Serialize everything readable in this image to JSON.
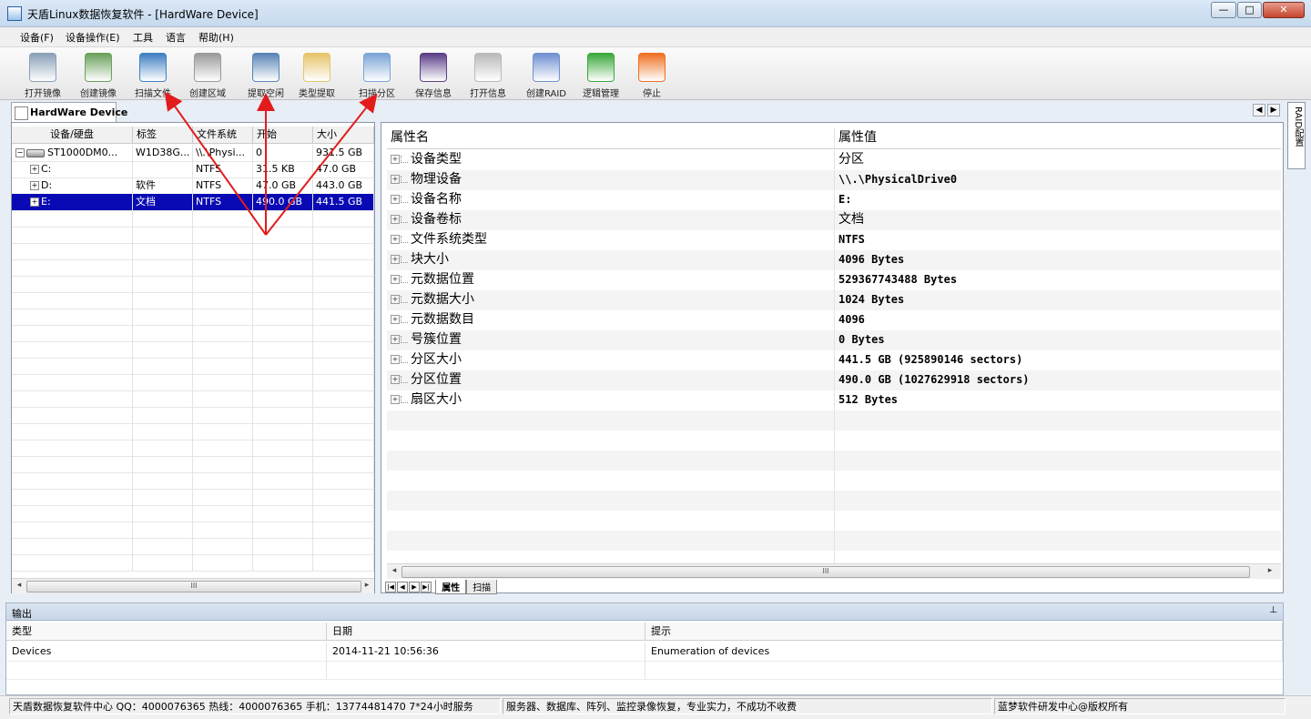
{
  "window": {
    "title": "天盾Linux数据恢复软件 - [HardWare Device]",
    "controls": {
      "minimize": "—",
      "maximize": "□",
      "close": "✕"
    }
  },
  "menu": [
    "设备(F)",
    "设备操作(E)",
    "工具",
    "语言",
    "帮助(H)"
  ],
  "toolbar": [
    {
      "label": "打开镜像",
      "icon": "open-image-icon",
      "color": "#8aa0b8"
    },
    {
      "label": "创建镜像",
      "icon": "create-image-icon",
      "color": "#6aa05a"
    },
    {
      "label": "扫描文件",
      "icon": "scan-file-icon",
      "color": "#3f7fc2"
    },
    {
      "label": "创建区域",
      "icon": "create-region-icon",
      "color": "#9a9a9a"
    },
    {
      "label": "提取空闲",
      "icon": "extract-free-icon",
      "color": "#5a84b6"
    },
    {
      "label": "类型提取",
      "icon": "type-extract-icon",
      "color": "#e6c46a"
    },
    {
      "label": "扫描分区",
      "icon": "scan-partition-icon",
      "color": "#7aa4d6"
    },
    {
      "label": "保存信息",
      "icon": "save-info-icon",
      "color": "#5b3f88"
    },
    {
      "label": "打开信息",
      "icon": "open-info-icon",
      "color": "#b9b9b9"
    },
    {
      "label": "创建RAID",
      "icon": "create-raid-icon",
      "color": "#6f8fd0"
    },
    {
      "label": "逻辑管理",
      "icon": "logic-manage-icon",
      "color": "#3aa83a"
    },
    {
      "label": "停止",
      "icon": "stop-icon",
      "color": "#f07020"
    }
  ],
  "doc_tab": {
    "label": "HardWare Device"
  },
  "nav": {
    "prev": "◀",
    "next": "▶"
  },
  "device_grid": {
    "columns": [
      "设备/硬盘",
      "标签",
      "文件系统",
      "开始",
      "大小"
    ],
    "rows": [
      {
        "name": "ST1000DM0...",
        "label": "W1D38G...",
        "fs": "\\\\.\\Physi...",
        "start": "0",
        "size": "931.5 GB",
        "expander": "−",
        "icon": "hdd-icon"
      },
      {
        "name": "C:",
        "label": "",
        "fs": "NTFS",
        "start": "31.5 KB",
        "size": "47.0 GB",
        "expander": "+",
        "icon": ""
      },
      {
        "name": "D:",
        "label": "软件",
        "fs": "NTFS",
        "start": "47.0 GB",
        "size": "443.0 GB",
        "expander": "+",
        "icon": ""
      },
      {
        "name": "E:",
        "label": "文档",
        "fs": "NTFS",
        "start": "490.0 GB",
        "size": "441.5 GB",
        "expander": "+",
        "icon": "",
        "selected": true
      }
    ],
    "scroll": {
      "left": "◂",
      "right": "▸",
      "thumb": "III"
    }
  },
  "properties": {
    "columns": [
      "属性名",
      "属性值"
    ],
    "rows": [
      {
        "name": "设备类型",
        "value": "分区",
        "cjk": true
      },
      {
        "name": "物理设备",
        "value": "\\\\.\\PhysicalDrive0"
      },
      {
        "name": "设备名称",
        "value": "E:"
      },
      {
        "name": "设备卷标",
        "value": "文档",
        "cjk": true
      },
      {
        "name": "文件系统类型",
        "value": "NTFS"
      },
      {
        "name": "块大小",
        "value": "4096 Bytes"
      },
      {
        "name": "元数据位置",
        "value": "529367743488 Bytes"
      },
      {
        "name": "元数据大小",
        "value": "1024 Bytes"
      },
      {
        "name": "元数据数目",
        "value": "4096"
      },
      {
        "name": "号簇位置",
        "value": "0 Bytes"
      },
      {
        "name": "分区大小",
        "value": "441.5 GB (925890146 sectors)"
      },
      {
        "name": "分区位置",
        "value": "490.0 GB (1027629918 sectors)"
      },
      {
        "name": "扇区大小",
        "value": "512 Bytes"
      }
    ],
    "tabs": [
      "属性",
      "扫描"
    ],
    "tab_nav": [
      "|◀",
      "◀",
      "▶",
      "▶|"
    ],
    "scroll": {
      "left": "◂",
      "right": "▸",
      "thumb": "III"
    }
  },
  "side_tab": {
    "label": "RAID配置"
  },
  "output": {
    "title": "输出",
    "pin": "⊥",
    "columns": [
      "类型",
      "日期",
      "提示"
    ],
    "rows": [
      {
        "type": "Devices",
        "date": "2014-11-21 10:56:36",
        "hint": "Enumeration of devices"
      }
    ]
  },
  "status": [
    "天盾数据恢复软件中心 QQ：4000076365 热线：4000076365 手机：13774481470  7*24小时服务",
    "服务器、数据库、阵列、监控录像恢复，专业实力，不成功不收费",
    "蓝梦软件研发中心@版权所有"
  ]
}
